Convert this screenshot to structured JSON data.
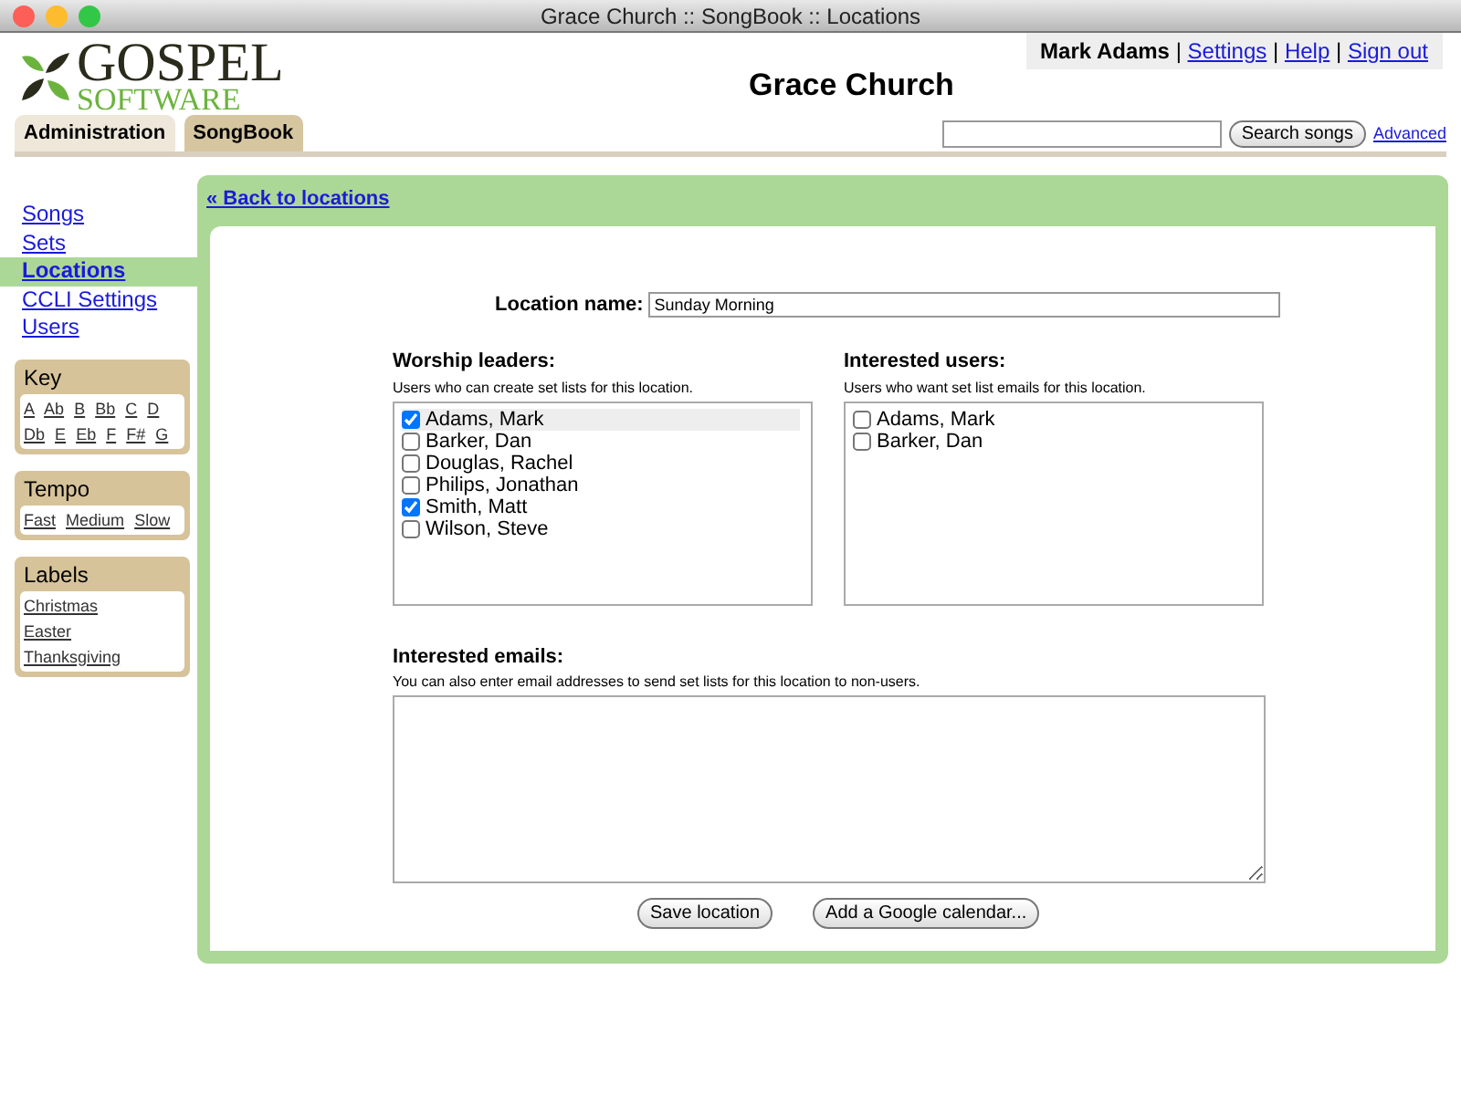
{
  "window": {
    "title": "Grace Church :: SongBook :: Locations"
  },
  "logo": {
    "line_1": "GOSPEL",
    "line_2": "SOFTWARE"
  },
  "site_title": "Grace Church",
  "user_bar": {
    "user": "Mark Adams",
    "separator": "|",
    "links": [
      "Settings",
      "Help",
      "Sign out"
    ]
  },
  "tabs": [
    {
      "label": "Administration",
      "selected": false
    },
    {
      "label": "SongBook",
      "selected": true
    }
  ],
  "search": {
    "button": "Search songs",
    "advanced": "Advanced"
  },
  "sidebar": {
    "items": [
      {
        "label": "Songs",
        "selected": false
      },
      {
        "label": "Sets",
        "selected": false
      },
      {
        "label": "Locations",
        "selected": true
      },
      {
        "label": "CCLI Settings",
        "selected": false
      },
      {
        "label": "Users",
        "selected": false
      }
    ],
    "boxes": [
      {
        "title": "Key",
        "kind": "inline",
        "links": [
          "A",
          "Ab",
          "B",
          "Bb",
          "C",
          "D",
          "Db",
          "E",
          "Eb",
          "F",
          "F#",
          "G"
        ]
      },
      {
        "title": "Tempo",
        "kind": "inline",
        "links": [
          "Fast",
          "Medium",
          "Slow"
        ]
      },
      {
        "title": "Labels",
        "kind": "list",
        "links": [
          "Christmas",
          "Easter",
          "Thanksgiving"
        ]
      }
    ]
  },
  "back_link": "« Back to locations",
  "form": {
    "name_label": "Location name:",
    "name_value": "Sunday Morning",
    "worship_leaders": {
      "title": "Worship leaders:",
      "hint": "Users who can create set lists for this location.",
      "users": [
        {
          "name": "Adams, Mark",
          "checked": true,
          "highlighted": true
        },
        {
          "name": "Barker, Dan",
          "checked": false,
          "highlighted": false
        },
        {
          "name": "Douglas, Rachel",
          "checked": false,
          "highlighted": false
        },
        {
          "name": "Philips, Jonathan",
          "checked": false,
          "highlighted": false
        },
        {
          "name": "Smith, Matt",
          "checked": true,
          "highlighted": false
        },
        {
          "name": "Wilson, Steve",
          "checked": false,
          "highlighted": false
        }
      ]
    },
    "interested_users": {
      "title": "Interested users:",
      "hint": "Users who want set list emails for this location.",
      "users": [
        {
          "name": "Adams, Mark",
          "checked": false,
          "highlighted": false
        },
        {
          "name": "Barker, Dan",
          "checked": false,
          "highlighted": false
        }
      ]
    },
    "emails": {
      "title": "Interested emails:",
      "hint": "You can also enter email addresses to send set lists for this location to non-users."
    },
    "buttons": [
      "Save location",
      "Add a Google calendar..."
    ]
  }
}
